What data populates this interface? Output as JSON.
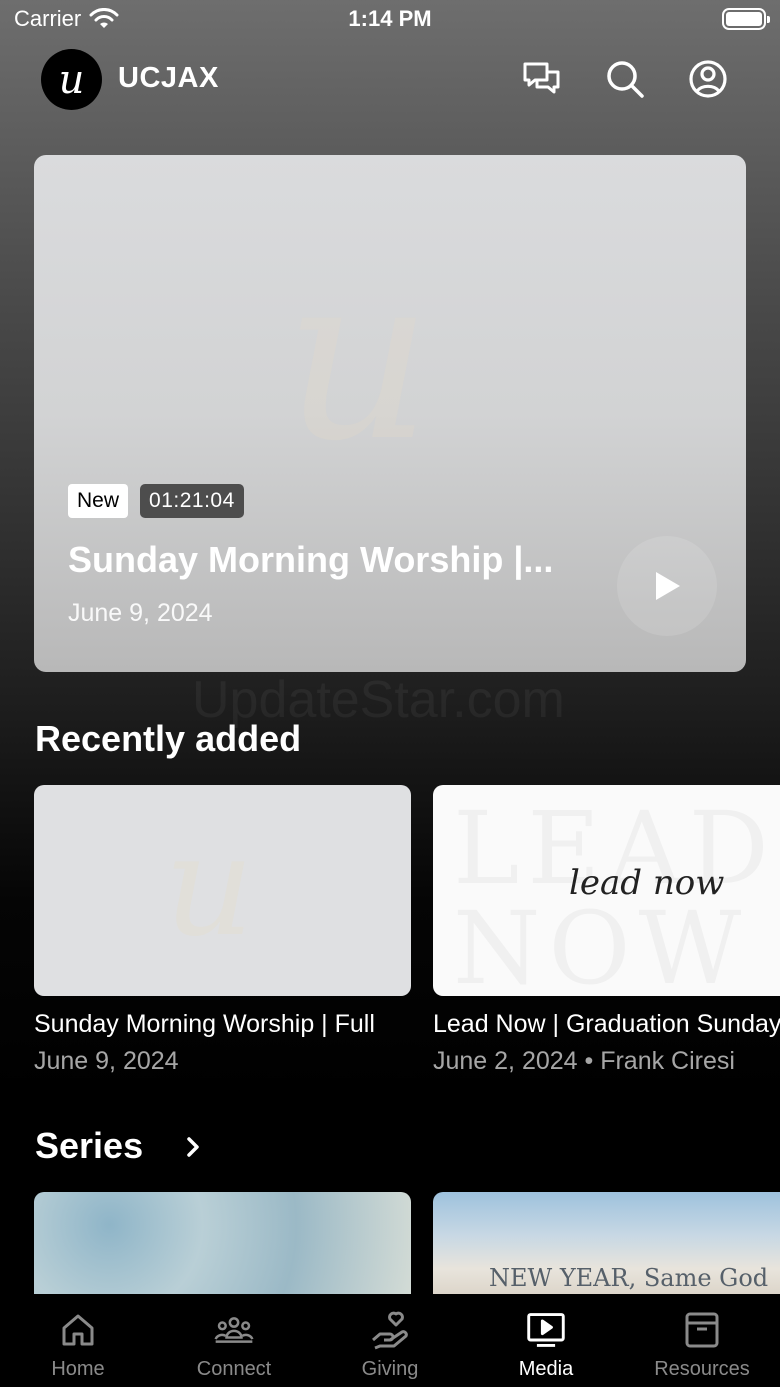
{
  "status_bar": {
    "carrier": "Carrier",
    "time": "1:14 PM"
  },
  "header": {
    "app_title": "UCJAX",
    "logo_letter": "u"
  },
  "hero": {
    "badge_new": "New",
    "duration": "01:21:04",
    "title": "Sunday Morning Worship |...",
    "date": "June 9, 2024"
  },
  "watermark_text": "UpdateStar.com",
  "recently_added": {
    "title": "Recently added",
    "items": [
      {
        "title": "Sunday Morning Worship | Full",
        "meta": "June 9, 2024"
      },
      {
        "title": "Lead Now | Graduation Sunday",
        "meta": "June 2, 2024 • Frank Ciresi",
        "thumb_bg_top": "LEAD",
        "thumb_bg_bottom": "NOW",
        "thumb_script": "lead now"
      }
    ]
  },
  "series": {
    "title": "Series",
    "items": [
      {
        "thumb_text": ""
      },
      {
        "thumb_text": "NEW YEAR, Same God"
      }
    ]
  },
  "tab_bar": {
    "tabs": [
      {
        "label": "Home",
        "icon": "home-icon"
      },
      {
        "label": "Connect",
        "icon": "people-icon"
      },
      {
        "label": "Giving",
        "icon": "hand-heart-icon"
      },
      {
        "label": "Media",
        "icon": "tv-play-icon",
        "active": true
      },
      {
        "label": "Resources",
        "icon": "archive-icon"
      }
    ]
  },
  "colors": {
    "active_tab": "#ffffff",
    "inactive_tab": "#8a8a8a"
  }
}
